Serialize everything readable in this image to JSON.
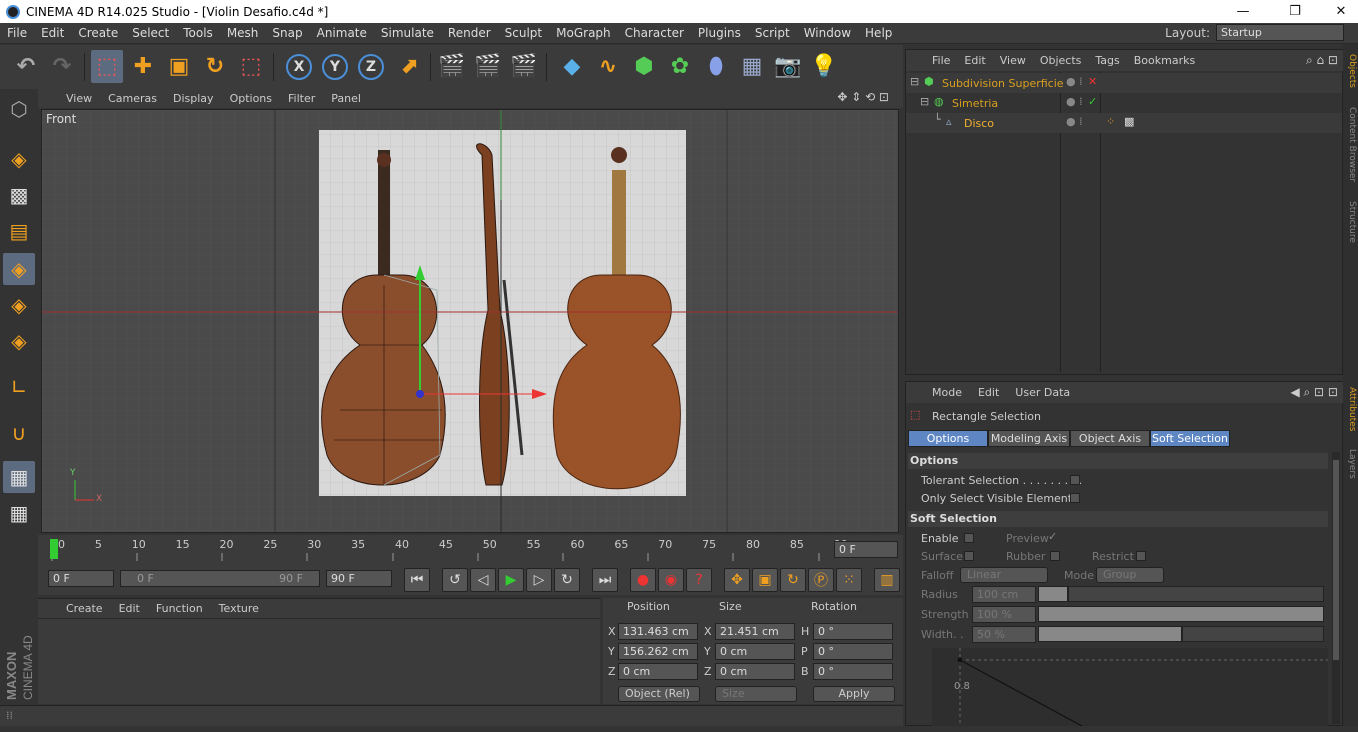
{
  "window": {
    "title": "CINEMA 4D R14.025 Studio - [Violin Desafio.c4d *]",
    "controls": [
      "—",
      "❐",
      "✕"
    ]
  },
  "menu": [
    "File",
    "Edit",
    "Create",
    "Select",
    "Tools",
    "Mesh",
    "Snap",
    "Animate",
    "Simulate",
    "Render",
    "Sculpt",
    "MoGraph",
    "Character",
    "Plugins",
    "Script",
    "Window",
    "Help"
  ],
  "layout": {
    "label": "Layout:",
    "value": "Startup"
  },
  "toolbar": {
    "axis_x": "X",
    "axis_y": "Y",
    "axis_z": "Z"
  },
  "viewport": {
    "menu": [
      "View",
      "Cameras",
      "Display",
      "Options",
      "Filter",
      "Panel"
    ],
    "label": "Front",
    "axis_y": "Y",
    "axis_x": "X"
  },
  "timeline": {
    "ticks": [
      "0",
      "5",
      "10",
      "15",
      "20",
      "25",
      "30",
      "35",
      "40",
      "45",
      "50",
      "55",
      "60",
      "65",
      "70",
      "75",
      "80",
      "85",
      "90"
    ],
    "current_frame": "0 F",
    "start_frame": "0 F",
    "range_start": "0 F",
    "range_end": "90 F",
    "end_frame": "90 F"
  },
  "materials": {
    "menu": [
      "Create",
      "Edit",
      "Function",
      "Texture"
    ]
  },
  "coords": {
    "headers": {
      "position": "Position",
      "size": "Size",
      "rotation": "Rotation"
    },
    "rows": [
      {
        "pl": "X",
        "pv": "131.463 cm",
        "sl": "X",
        "sv": "21.451 cm",
        "rl": "H",
        "rv": "0 °"
      },
      {
        "pl": "Y",
        "pv": "156.262 cm",
        "sl": "Y",
        "sv": "0 cm",
        "rl": "P",
        "rv": "0 °"
      },
      {
        "pl": "Z",
        "pv": "0 cm",
        "sl": "Z",
        "sv": "0 cm",
        "rl": "B",
        "rv": "0 °"
      }
    ],
    "mode": "Object (Rel)",
    "size_mode": "Size",
    "apply": "Apply"
  },
  "objects": {
    "menu": [
      "File",
      "Edit",
      "View",
      "Objects",
      "Tags",
      "Bookmarks"
    ],
    "items": [
      {
        "name": "Subdivision Superficie",
        "color": "#d9a020"
      },
      {
        "name": "Simetria",
        "color": "#d9a020"
      },
      {
        "name": "Disco",
        "color": "#f0b030"
      }
    ]
  },
  "attributes": {
    "menu": [
      "Mode",
      "Edit",
      "User Data"
    ],
    "tool_name": "Rectangle Selection",
    "tabs": [
      "Options",
      "Modeling Axis",
      "Object Axis",
      "Soft Selection"
    ],
    "section_options": "Options",
    "tolerant": "Tolerant Selection . . . . . . . . .",
    "only_visible": "Only Select Visible Elements",
    "section_soft": "Soft Selection",
    "enable": "Enable",
    "preview": "Preview",
    "surface": "Surface",
    "rubber": "Rubber",
    "restrict": "Restrict",
    "falloff": "Falloff",
    "falloff_value": "Linear",
    "mode": "Mode",
    "mode_value": "Group",
    "radius": "Radius",
    "radius_value": "100 cm",
    "strength": "Strength",
    "strength_value": "100 %",
    "width": "Width. .",
    "width_value": "50 %",
    "graph_label": "0.8"
  },
  "right_tabs": [
    "Objects",
    "Content Browser",
    "Structure",
    "Attributes",
    "Layers"
  ],
  "brand": {
    "maxon": "MAXON",
    "product": "CINEMA 4D"
  }
}
